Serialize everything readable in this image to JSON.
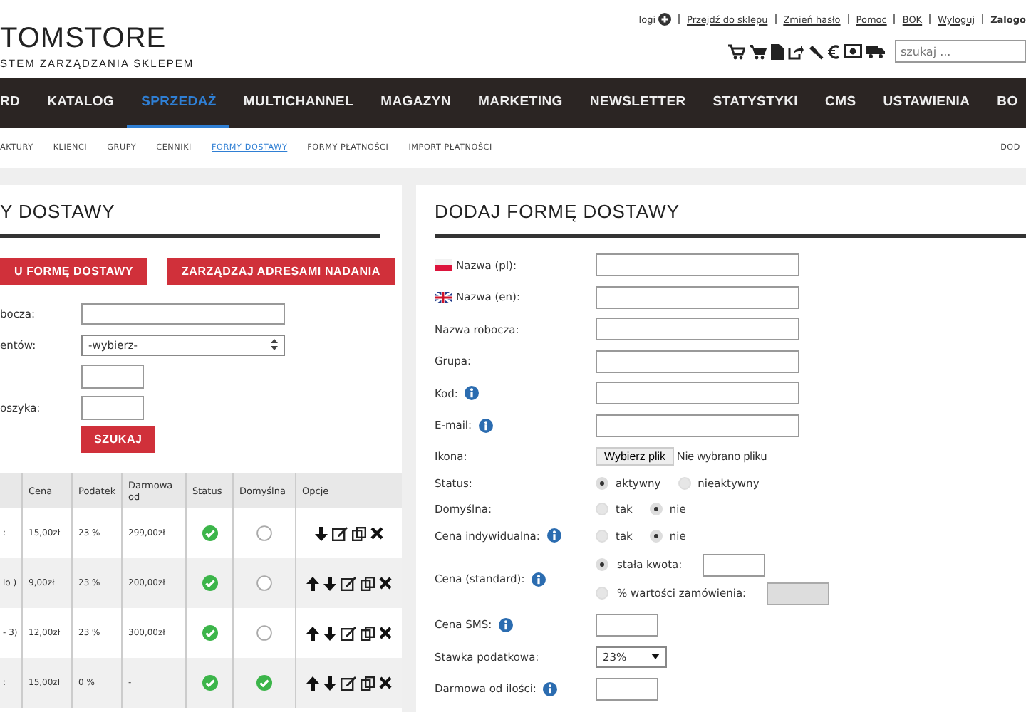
{
  "header": {
    "logo": "TOMSTORE",
    "tagline": "STEM ZARZĄDZANIA SKLEPEM",
    "top_links": [
      {
        "label": "logi",
        "kind": "plus"
      },
      {
        "label": "Przejdź do sklepu",
        "kind": "link"
      },
      {
        "label": "Zmień hasło",
        "kind": "link"
      },
      {
        "label": "Pomoc",
        "kind": "link"
      },
      {
        "label": "BOK",
        "kind": "link"
      },
      {
        "label": "Wyloguj",
        "kind": "link"
      },
      {
        "label": "Zalogo",
        "kind": "bold"
      }
    ],
    "search": {
      "placeholder": "szukaj ..."
    }
  },
  "nav": [
    {
      "label": "RD",
      "selected": false
    },
    {
      "label": "KATALOG",
      "selected": false
    },
    {
      "label": "SPRZEDAŻ",
      "selected": true
    },
    {
      "label": "MULTICHANNEL",
      "selected": false
    },
    {
      "label": "MAGAZYN",
      "selected": false
    },
    {
      "label": "MARKETING",
      "selected": false
    },
    {
      "label": "NEWSLETTER",
      "selected": false
    },
    {
      "label": "STATYSTYKI",
      "selected": false
    },
    {
      "label": "CMS",
      "selected": false
    },
    {
      "label": "USTAWIENIA",
      "selected": false
    },
    {
      "label": "BO",
      "selected": false
    }
  ],
  "subnav": {
    "items": [
      {
        "label": "AKTURY",
        "selected": false
      },
      {
        "label": "KLIENCI",
        "selected": false
      },
      {
        "label": "GRUPY",
        "selected": false
      },
      {
        "label": "CENNIKI",
        "selected": false
      },
      {
        "label": "FORMY DOSTAWY",
        "selected": true
      },
      {
        "label": "FORMY PŁATNOŚCI",
        "selected": false
      },
      {
        "label": "IMPORT PŁATNOŚCI",
        "selected": false
      }
    ],
    "right": "DOD"
  },
  "left_panel": {
    "title": "Y DOSTAWY",
    "buttons": [
      "U FORMĘ DOSTAWY",
      "ZARZĄDZAJ ADRESAMI NADANIA"
    ],
    "filters": [
      {
        "label": "bocza:",
        "kind": "text"
      },
      {
        "label": "entów:",
        "kind": "select",
        "value": "-wybierz-"
      },
      {
        "kind": "short"
      },
      {
        "label": "oszyka:",
        "kind": "short"
      }
    ],
    "search_button": "SZUKAJ",
    "table": {
      "columns": [
        "Cena",
        "Podatek",
        "Darmowa od",
        "Status",
        "Domyślna",
        "Opcje"
      ],
      "rows": [
        {
          "column_1": ":",
          "price": "15,00zł",
          "tax": "23 %",
          "free_from": "299,00zł",
          "active": true,
          "default": false,
          "can_move_up": false
        },
        {
          "column_1": "lo )",
          "price": "9,00zł",
          "tax": "23 %",
          "free_from": "200,00zł",
          "active": true,
          "default": false,
          "can_move_up": true
        },
        {
          "column_1": "- 3)",
          "price": "12,00zł",
          "tax": "23 %",
          "free_from": "300,00zł",
          "active": true,
          "default": false,
          "can_move_up": true
        },
        {
          "column_1": ":",
          "price": "15,00zł",
          "tax": "0 %",
          "free_from": "-",
          "active": true,
          "default": true,
          "can_move_up": true
        }
      ]
    }
  },
  "right_panel": {
    "title": "DODAJ FORMĘ DOSTAWY",
    "fields": [
      {
        "label": "Nazwa (pl):",
        "kind": "polish",
        "info": false
      },
      {
        "label": "Nazwa (en):",
        "kind": "english",
        "info": false
      },
      {
        "label": "Nazwa robocza:",
        "kind": "text",
        "info": false
      },
      {
        "label": "Grupa:",
        "kind": "text",
        "info": false
      },
      {
        "label": "Kod:",
        "kind": "text",
        "info": true
      },
      {
        "label": "E-mail:",
        "kind": "text",
        "info": true
      },
      {
        "label": "Ikona:",
        "kind": "file",
        "button": "Wybierz plik",
        "note": "Nie wybrano pliku",
        "info": false
      },
      {
        "label": "Status:",
        "kind": "radio",
        "info": false,
        "options": [
          {
            "label": "aktywny",
            "selected": true
          },
          {
            "label": "nieaktywny",
            "selected": false
          }
        ]
      },
      {
        "label": "Domyślna:",
        "kind": "radio",
        "info": false,
        "options": [
          {
            "label": "tak",
            "selected": false
          },
          {
            "label": "nie",
            "selected": true
          }
        ]
      },
      {
        "label": "Cena indywidualna:",
        "kind": "radio",
        "info": true,
        "options": [
          {
            "label": "tak",
            "selected": false
          },
          {
            "label": "nie",
            "selected": true
          }
        ]
      },
      {
        "label": "Cena (standard):",
        "kind": "price",
        "info": true,
        "options": [
          {
            "label": "stała kwota:",
            "selected": true,
            "disabled": false
          },
          {
            "label": "% wartości zamówienia:",
            "selected": false,
            "disabled": true
          }
        ]
      },
      {
        "label": "Cena SMS:",
        "kind": "short",
        "info": true
      },
      {
        "label": "Stawka podatkowa:",
        "kind": "select",
        "value": "23%",
        "info": false
      },
      {
        "label": "Darmowa od ilości:",
        "kind": "short",
        "info": true
      }
    ]
  }
}
